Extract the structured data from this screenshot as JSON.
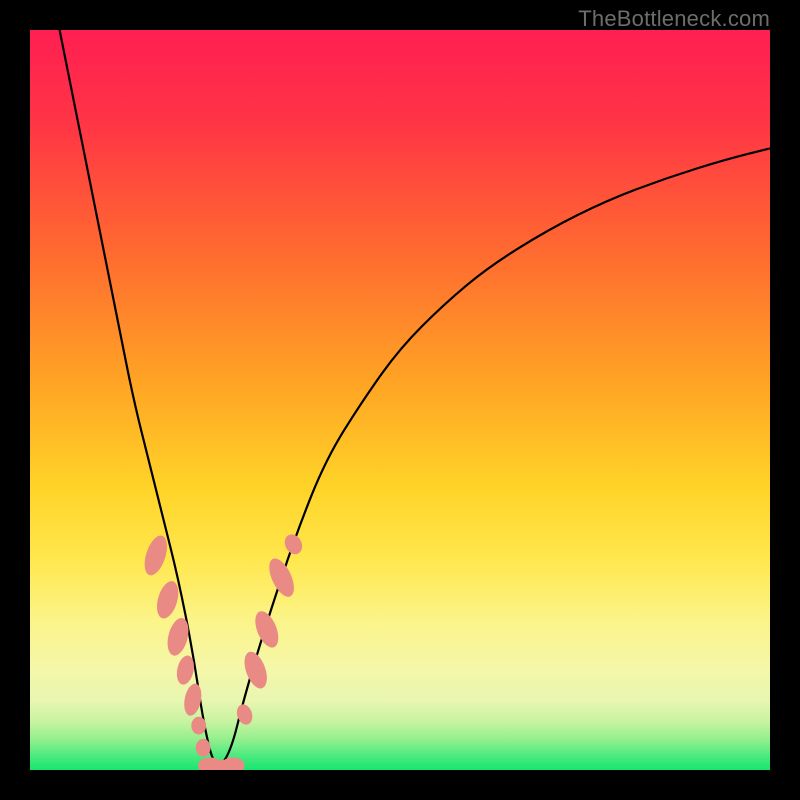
{
  "attribution": "TheBottleneck.com",
  "colors": {
    "frame": "#000000",
    "curve": "#000000",
    "marker_fill": "#e98b84",
    "marker_stroke": "#d86e66",
    "gradient_top": "#ff1f52",
    "gradient_mid1": "#ff7a2a",
    "gradient_mid2": "#ffd92e",
    "gradient_mid3": "#faf78e",
    "gradient_bottom": "#17e86f"
  },
  "chart_data": {
    "type": "line",
    "title": "",
    "xlabel": "",
    "ylabel": "",
    "xlim": [
      0,
      100
    ],
    "ylim": [
      0,
      100
    ],
    "series": [
      {
        "name": "bottleneck-curve",
        "x": [
          4,
          6,
          8,
          10,
          12,
          14,
          16,
          18,
          20,
          22,
          23.5,
          25,
          27,
          29,
          32,
          36,
          40,
          45,
          50,
          56,
          62,
          70,
          78,
          86,
          94,
          100
        ],
        "y": [
          100,
          90,
          80,
          70,
          60,
          50,
          42,
          34,
          26,
          16,
          6,
          0,
          2,
          10,
          20,
          32,
          42,
          50,
          57,
          63,
          68,
          73,
          77,
          80,
          82.5,
          84
        ]
      }
    ],
    "markers": [
      {
        "shape": "round",
        "x": 17.0,
        "y": 29.0,
        "rx": 1.3,
        "ry": 2.8,
        "rot": 18
      },
      {
        "shape": "round",
        "x": 18.6,
        "y": 23.0,
        "rx": 1.3,
        "ry": 2.6,
        "rot": 16
      },
      {
        "shape": "round",
        "x": 20.0,
        "y": 18.0,
        "rx": 1.3,
        "ry": 2.6,
        "rot": 14
      },
      {
        "shape": "round",
        "x": 21.0,
        "y": 13.5,
        "rx": 1.1,
        "ry": 2.0,
        "rot": 12
      },
      {
        "shape": "round",
        "x": 22.0,
        "y": 9.5,
        "rx": 1.1,
        "ry": 2.2,
        "rot": 11
      },
      {
        "shape": "round",
        "x": 22.8,
        "y": 6.0,
        "rx": 1.0,
        "ry": 1.2,
        "rot": 0
      },
      {
        "shape": "round",
        "x": 23.4,
        "y": 3.0,
        "rx": 1.0,
        "ry": 1.2,
        "rot": 0
      },
      {
        "shape": "round",
        "x": 24.3,
        "y": 0.6,
        "rx": 1.6,
        "ry": 1.1,
        "rot": 0
      },
      {
        "shape": "round",
        "x": 25.8,
        "y": 0.3,
        "rx": 1.8,
        "ry": 1.1,
        "rot": 0
      },
      {
        "shape": "round",
        "x": 27.4,
        "y": 0.6,
        "rx": 1.6,
        "ry": 1.1,
        "rot": 0
      },
      {
        "shape": "round",
        "x": 29.0,
        "y": 7.5,
        "rx": 1.0,
        "ry": 1.4,
        "rot": -18
      },
      {
        "shape": "round",
        "x": 30.5,
        "y": 13.5,
        "rx": 1.3,
        "ry": 2.6,
        "rot": -20
      },
      {
        "shape": "round",
        "x": 32.0,
        "y": 19.0,
        "rx": 1.3,
        "ry": 2.6,
        "rot": -22
      },
      {
        "shape": "round",
        "x": 34.0,
        "y": 26.0,
        "rx": 1.3,
        "ry": 2.8,
        "rot": -25
      },
      {
        "shape": "round",
        "x": 35.6,
        "y": 30.5,
        "rx": 1.1,
        "ry": 1.4,
        "rot": -28
      }
    ],
    "gradient_stops": [
      {
        "offset": 0.0,
        "color": "#ff1f52"
      },
      {
        "offset": 0.12,
        "color": "#ff3346"
      },
      {
        "offset": 0.3,
        "color": "#ff6a30"
      },
      {
        "offset": 0.48,
        "color": "#ffa524"
      },
      {
        "offset": 0.62,
        "color": "#ffd428"
      },
      {
        "offset": 0.72,
        "color": "#ffe850"
      },
      {
        "offset": 0.8,
        "color": "#fbf48a"
      },
      {
        "offset": 0.86,
        "color": "#f5f7a8"
      },
      {
        "offset": 0.905,
        "color": "#e9f6b0"
      },
      {
        "offset": 0.935,
        "color": "#c7f3a0"
      },
      {
        "offset": 0.96,
        "color": "#8fef8c"
      },
      {
        "offset": 0.985,
        "color": "#3fe97c"
      },
      {
        "offset": 1.0,
        "color": "#17e86f"
      }
    ]
  }
}
